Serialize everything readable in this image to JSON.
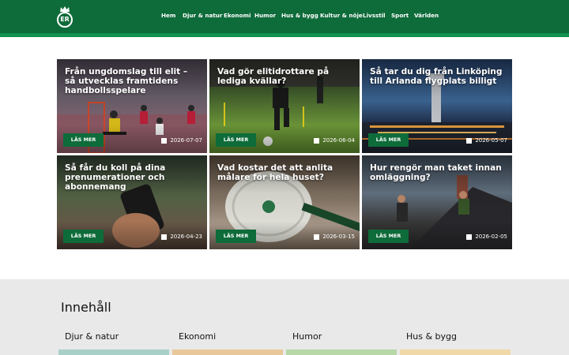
{
  "header": {
    "logo_text": "ER",
    "nav": [
      "Hem",
      "Djur & natur",
      "Ekonomi",
      "Humor",
      "Hus & bygg",
      "Kultur & nöje",
      "Livsstil",
      "Sport",
      "Världen"
    ]
  },
  "cards": [
    {
      "title": "Från ungdomslag till elit – så utvecklas framtidens handbollsspelare",
      "button": "LÄS MER",
      "date": "2026-07-07"
    },
    {
      "title": "Vad gör elitidrottare på lediga kvällar?",
      "button": "LÄS MER",
      "date": "2026-06-04"
    },
    {
      "title": "Så tar du dig från Linköping till Arlanda flygplats billigt",
      "button": "LÄS MER",
      "date": "2026-05-07"
    },
    {
      "title": "Så får du koll på dina prenumerationer och abonnemang",
      "button": "LÄS MER",
      "date": "2026-04-23"
    },
    {
      "title": "Vad kostar det att anlita målare för hela huset?",
      "button": "LÄS MER",
      "date": "2026-03-15"
    },
    {
      "title": "Hur rengör man taket innan omläggning?",
      "button": "LÄS MER",
      "date": "2026-02-05"
    }
  ],
  "content": {
    "heading": "Innehåll",
    "categories": [
      "Djur & natur",
      "Ekonomi",
      "Humor",
      "Hus & bygg"
    ]
  },
  "colors": {
    "header": "#0e6b3a",
    "stripe": "#129150",
    "button": "#0e6b3a",
    "section_bg": "#e9e9e9"
  }
}
